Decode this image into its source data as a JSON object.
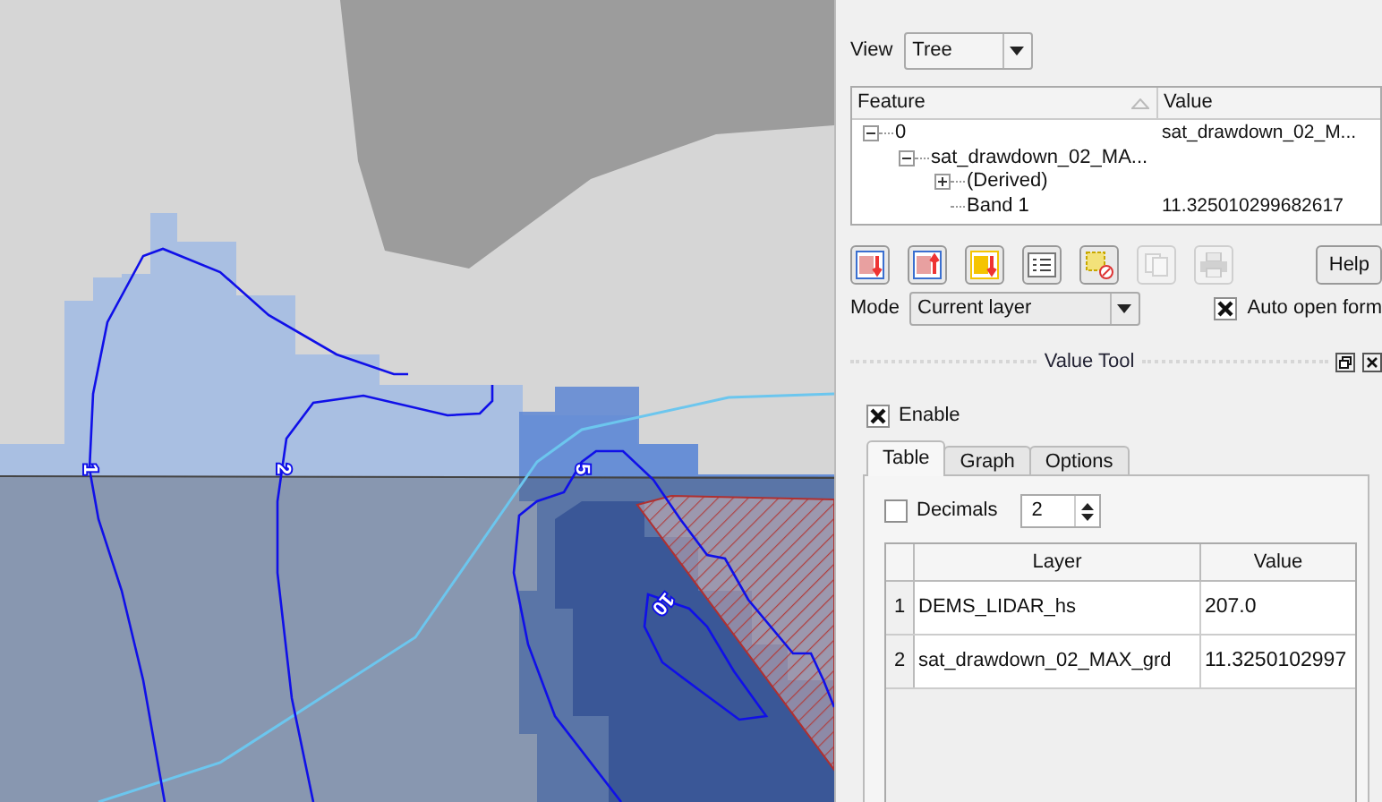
{
  "map": {
    "contour_labels": [
      "1",
      "2",
      "5",
      "10"
    ]
  },
  "identify": {
    "view": {
      "label": "View",
      "value": "Tree"
    },
    "tree": {
      "columns": [
        "Feature",
        "Value"
      ],
      "rows": [
        {
          "feature": "0",
          "value": "sat_drawdown_02_M...",
          "expanded": true,
          "children": [
            {
              "feature": "sat_drawdown_02_MA...",
              "expanded": true,
              "children": [
                {
                  "feature": "(Derived)",
                  "expanded": false
                },
                {
                  "feature": "Band 1",
                  "value": "11.325010299682617"
                }
              ]
            }
          ]
        }
      ]
    },
    "tools": [
      {
        "disabled": false
      },
      {
        "disabled": false
      },
      {
        "disabled": false
      },
      {
        "disabled": false
      },
      {
        "disabled": false
      },
      {
        "disabled": true
      },
      {
        "disabled": true
      }
    ],
    "help": "Help",
    "mode": {
      "label": "Mode",
      "value": "Current layer"
    },
    "auto_open_form": {
      "label": "Auto open form",
      "checked": true
    }
  },
  "value_tool": {
    "title": "Value Tool",
    "enable": {
      "label": "Enable",
      "checked": true
    },
    "tabs": [
      {
        "label": "Table",
        "selected": true
      },
      {
        "label": "Graph",
        "selected": false
      },
      {
        "label": "Options",
        "selected": false
      }
    ],
    "decimals": {
      "label": "Decimals",
      "checked": false,
      "value": "2"
    },
    "table": {
      "columns": [
        "Layer",
        "Value"
      ],
      "rows": [
        {
          "index": "1",
          "layer": "DEMS_LIDAR_hs",
          "value": "207.0"
        },
        {
          "index": "2",
          "layer": "sat_drawdown_02_MAX_grd",
          "value": "11.3250102997"
        }
      ]
    }
  }
}
